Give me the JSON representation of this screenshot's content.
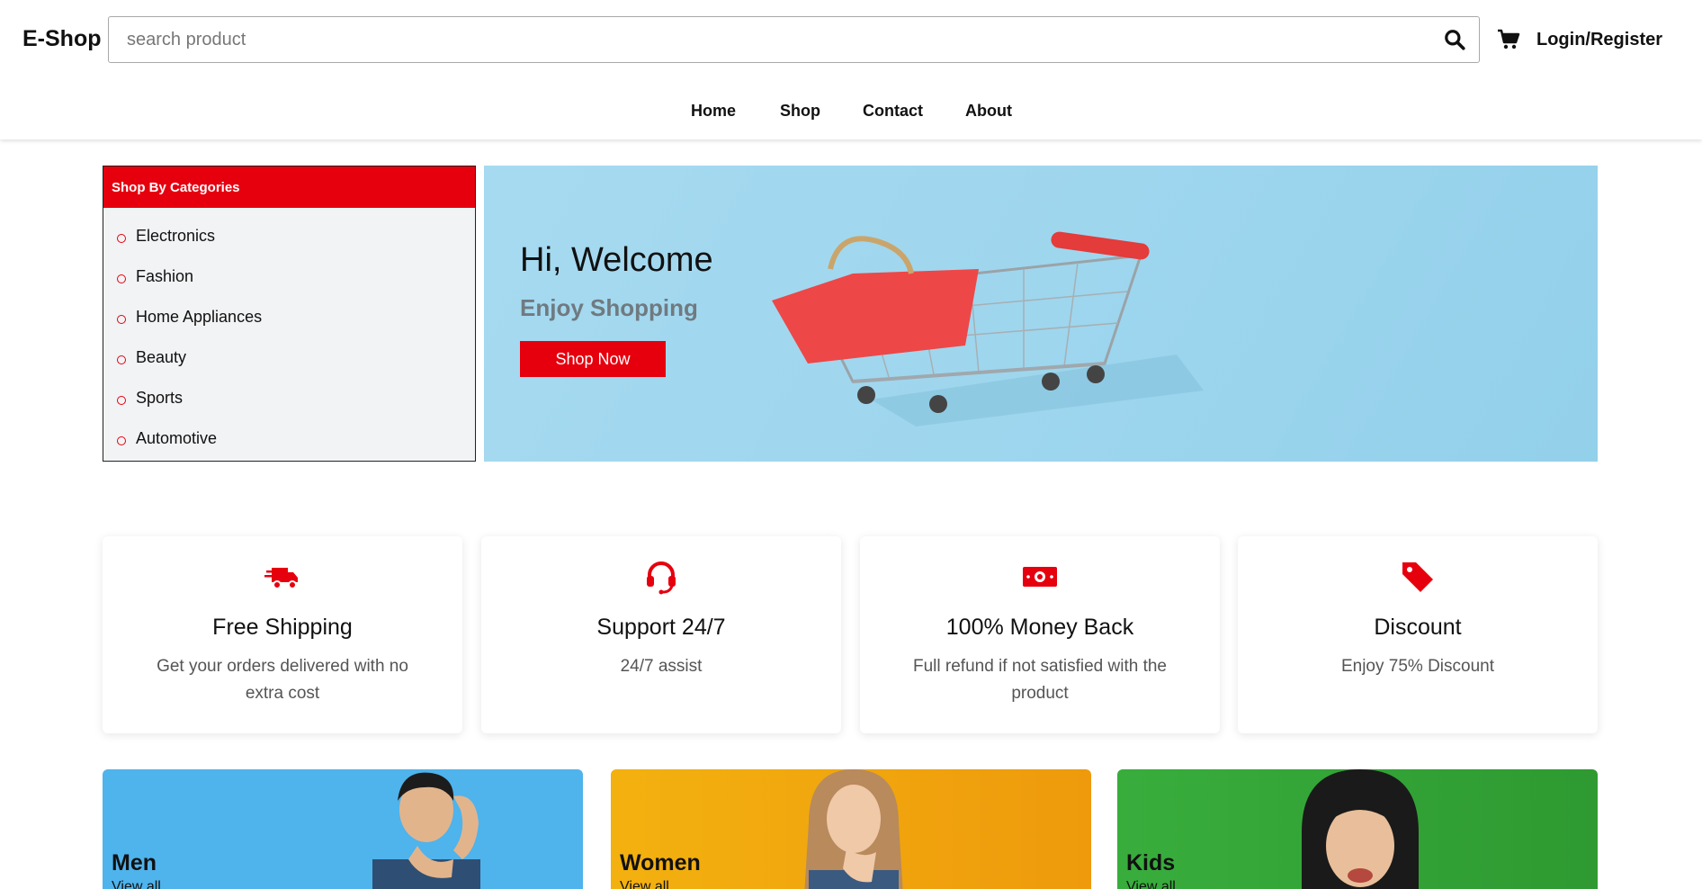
{
  "header": {
    "logo": "E-Shop",
    "search_placeholder": "search product",
    "login_label": "Login/Register"
  },
  "nav": [
    "Home",
    "Shop",
    "Contact",
    "About"
  ],
  "categories": {
    "title": "Shop By Categories",
    "items": [
      "Electronics",
      "Fashion",
      "Home Appliances",
      "Beauty",
      "Sports",
      "Automotive"
    ]
  },
  "hero": {
    "title": "Hi, Welcome",
    "subtitle": "Enjoy Shopping",
    "button": "Shop Now"
  },
  "features": [
    {
      "icon": "truck-icon",
      "title": "Free Shipping",
      "desc": "Get your orders delivered with no extra cost"
    },
    {
      "icon": "headset-icon",
      "title": "Support 24/7",
      "desc": "24/7 assist"
    },
    {
      "icon": "money-icon",
      "title": "100% Money Back",
      "desc": "Full refund if not satisfied with the product"
    },
    {
      "icon": "tag-icon",
      "title": "Discount",
      "desc": "Enjoy 75% Discount"
    }
  ],
  "collections": [
    {
      "title": "Men",
      "link": "View all",
      "color": "#4fb3ec"
    },
    {
      "title": "Women",
      "link": "View all",
      "color": "#f0a20e"
    },
    {
      "title": "Kids",
      "link": "View all",
      "color": "#36a73a"
    }
  ],
  "colors": {
    "accent": "#e6000e",
    "hero_bg": "#a6daf0"
  }
}
